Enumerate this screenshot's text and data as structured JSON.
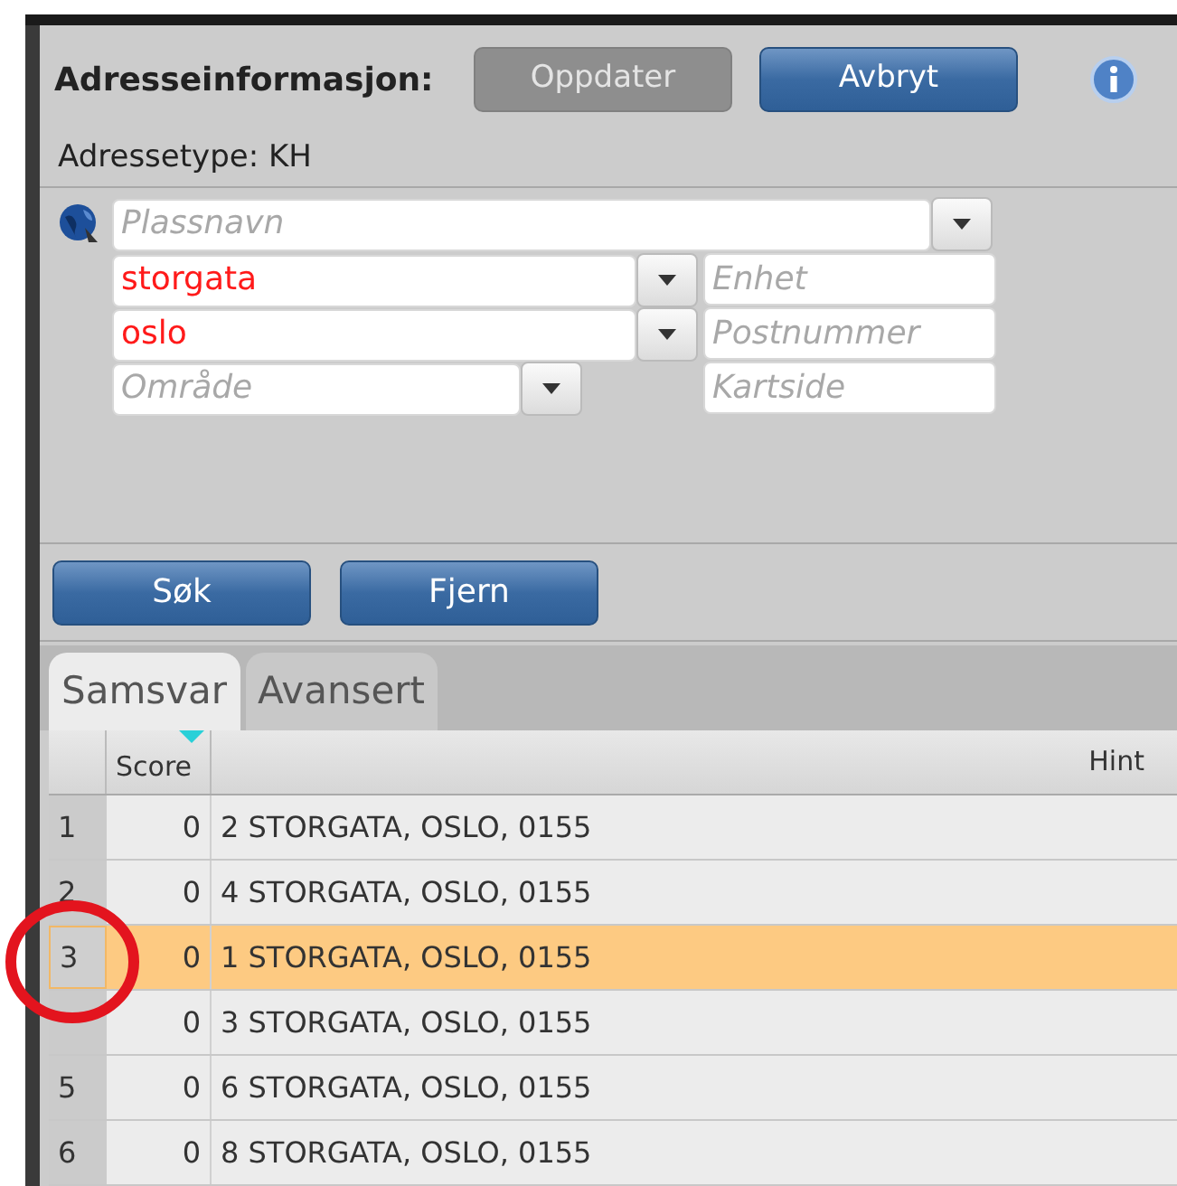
{
  "header": {
    "title": "Adresseinformasjon:",
    "buttons": [
      {
        "label": "Oppdater",
        "disabled": true
      },
      {
        "label": "Avbryt",
        "disabled": false
      }
    ]
  },
  "address_type": "Adressetype: KH",
  "form": {
    "place": {
      "placeholder": "Plassnavn"
    },
    "street": {
      "value": "storgata",
      "invalid": true
    },
    "city": {
      "value": "oslo",
      "invalid": true
    },
    "area": {
      "placeholder": "Område"
    },
    "unit": {
      "placeholder": "Enhet"
    },
    "postcode": {
      "placeholder": "Postnummer"
    },
    "map_page": {
      "placeholder": "Kartside"
    }
  },
  "actions": [
    {
      "label": "Søk"
    },
    {
      "label": "Fjern"
    }
  ],
  "tabs": [
    {
      "label": "Samsvar",
      "selected": true
    },
    {
      "label": "Avansert",
      "selected": false
    }
  ],
  "table": {
    "columns": [
      "Score",
      "Hint"
    ],
    "rows": [
      {
        "number": "1",
        "score": "0",
        "hint": "2 STORGATA, OSLO, 0155",
        "selected": false
      },
      {
        "number": "2",
        "score": "0",
        "hint": "4 STORGATA, OSLO, 0155",
        "selected": false
      },
      {
        "number": "3",
        "score": "0",
        "hint": "1 STORGATA, OSLO, 0155",
        "selected": true
      },
      {
        "score": "0",
        "hint": "3 STORGATA, OSLO, 0155",
        "selected": false
      },
      {
        "number": "5",
        "score": "0",
        "hint": "6 STORGATA, OSLO, 0155",
        "selected": false
      },
      {
        "number": "6",
        "score": "0",
        "hint": "8 STORGATA, OSLO, 0155",
        "selected": false
      }
    ]
  },
  "annotation": {
    "kind": "circle",
    "color": "#e3141e"
  }
}
